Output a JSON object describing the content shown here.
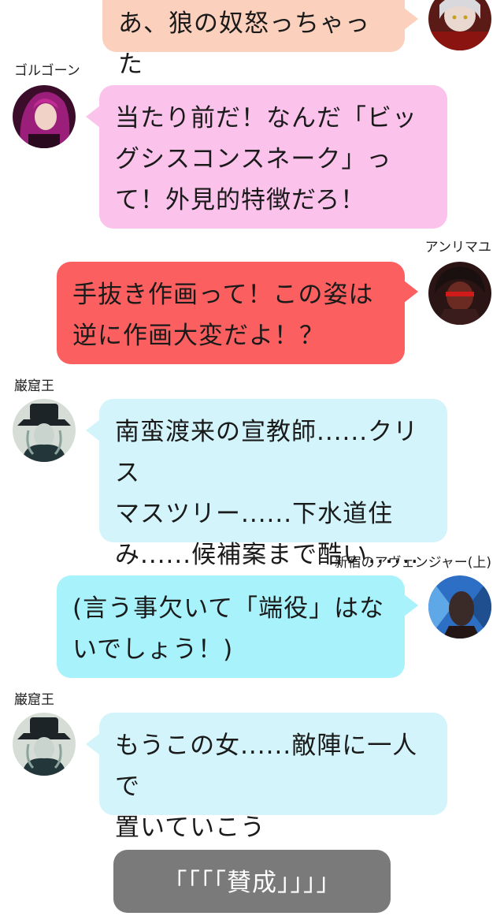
{
  "messages": [
    {
      "side": "right",
      "speaker": "",
      "color": "#fbd0bd",
      "lines": [
        "あ、狼の奴怒っちゃった"
      ],
      "avatar": "avatar-jeanne-alter"
    },
    {
      "side": "left",
      "speaker": "ゴルゴーン",
      "color": "#fbc2ec",
      "lines": [
        "当たり前だ！なんだ「ビッ",
        "グシスコンスネーク」っ",
        "て！外見的特徴だろ！"
      ],
      "avatar": "avatar-gorgon"
    },
    {
      "side": "right",
      "speaker": "アンリマユ",
      "color": "#fb5f5f",
      "lines": [
        "手抜き作画って！この姿は",
        "逆に作画大変だよ！？"
      ],
      "avatar": "avatar-angra-mainyu"
    },
    {
      "side": "left",
      "speaker": "巌窟王",
      "color": "#d3f4fb",
      "lines": [
        "南蛮渡来の宣教師......クリス",
        "マスツリー......下水道住",
        "み......候補案まで酷い......"
      ],
      "avatar": "avatar-edmond"
    },
    {
      "side": "right",
      "speaker": "新宿のアヴェンジャー(上)",
      "color": "#a7f2fb",
      "lines": [
        "(言う事欠いて「端役」はな",
        "いでしょう！)"
      ],
      "avatar": "avatar-shinjuku-avenger"
    },
    {
      "side": "left",
      "speaker": "巌窟王",
      "color": "#d3f4fb",
      "lines": [
        "もうこの女......敵陣に一人で",
        "置いていこう"
      ],
      "avatar": "avatar-edmond"
    }
  ],
  "vote": {
    "text": "「「「「賛成」」」」"
  }
}
